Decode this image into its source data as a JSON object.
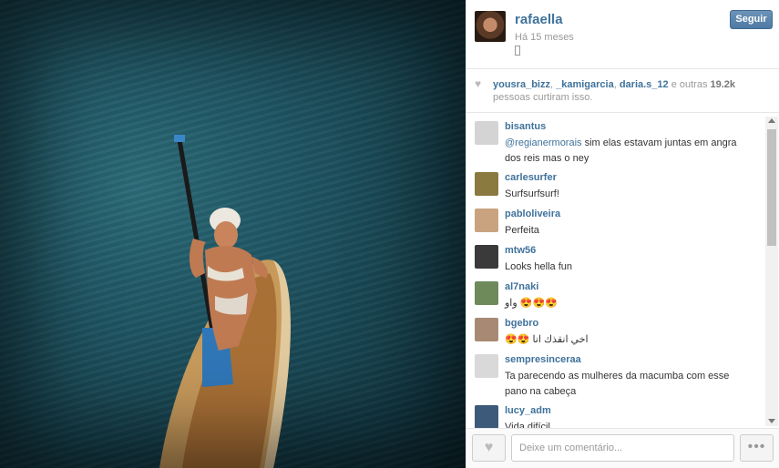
{
  "post": {
    "username": "rafaella",
    "time": "Há 15 meses",
    "follow_label": "Seguir",
    "photo_icon": "paddleboard-photo"
  },
  "likes": {
    "users": [
      "yousra_bizz",
      "_kamigarcia",
      "daria.s_12"
    ],
    "sep1": ", ",
    "sep2": ", ",
    "and_others": " e outras ",
    "count": "19.2k",
    "suffix": " pessoas curtiram isso."
  },
  "comments": [
    {
      "user": "bisantus",
      "mention": "@regianermorais",
      "text": " sim elas estavam juntas em angra dos reis mas o ney"
    },
    {
      "user": "carlesurfer",
      "mention": "",
      "text": "Surfsurfsurf!"
    },
    {
      "user": "pabloliveira",
      "mention": "",
      "text": "Perfeita"
    },
    {
      "user": "mtw56",
      "mention": "",
      "text": "Looks hella fun"
    },
    {
      "user": "al7naki",
      "mention": "",
      "text": "واو 😍😍😍"
    },
    {
      "user": "bgebro",
      "mention": "",
      "text": "😍😍 اخي انقذك انا"
    },
    {
      "user": "sempresinceraa",
      "mention": "",
      "text": "Ta parecendo as mulheres da macumba com esse pano na cabeça"
    },
    {
      "user": "lucy_adm",
      "mention": "",
      "text": "Vida difícil"
    }
  ],
  "footer": {
    "comment_placeholder": "Deixe um comentário...",
    "more_label": "•••"
  },
  "colors": {
    "link": "#3f729b",
    "follow_bg": "#517fa4"
  }
}
